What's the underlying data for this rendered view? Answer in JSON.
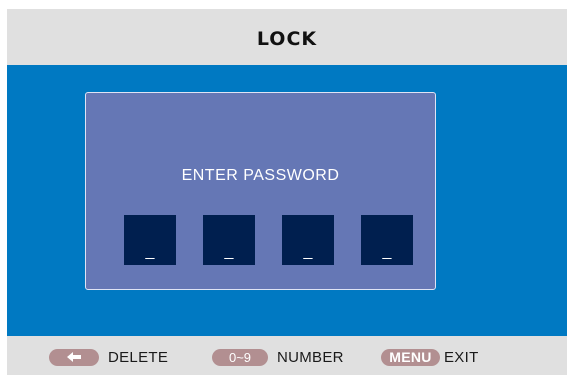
{
  "header": {
    "title": "LOCK"
  },
  "dialog": {
    "label": "ENTER PASSWORD",
    "slots": [
      "_",
      "_",
      "_",
      "_"
    ]
  },
  "footer": {
    "hints": [
      {
        "key_icon": "left-arrow-icon",
        "key_text": "",
        "label": "DELETE"
      },
      {
        "key_text": "0~9",
        "label": "NUMBER"
      },
      {
        "key_text": "MENU",
        "label": "EXIT"
      }
    ]
  },
  "colors": {
    "header_bg": "#e0e0e0",
    "main_bg": "#0079c2",
    "dialog_bg": "#6577b5",
    "slot_bg": "#001f4f",
    "key_bg": "#b28f91"
  }
}
